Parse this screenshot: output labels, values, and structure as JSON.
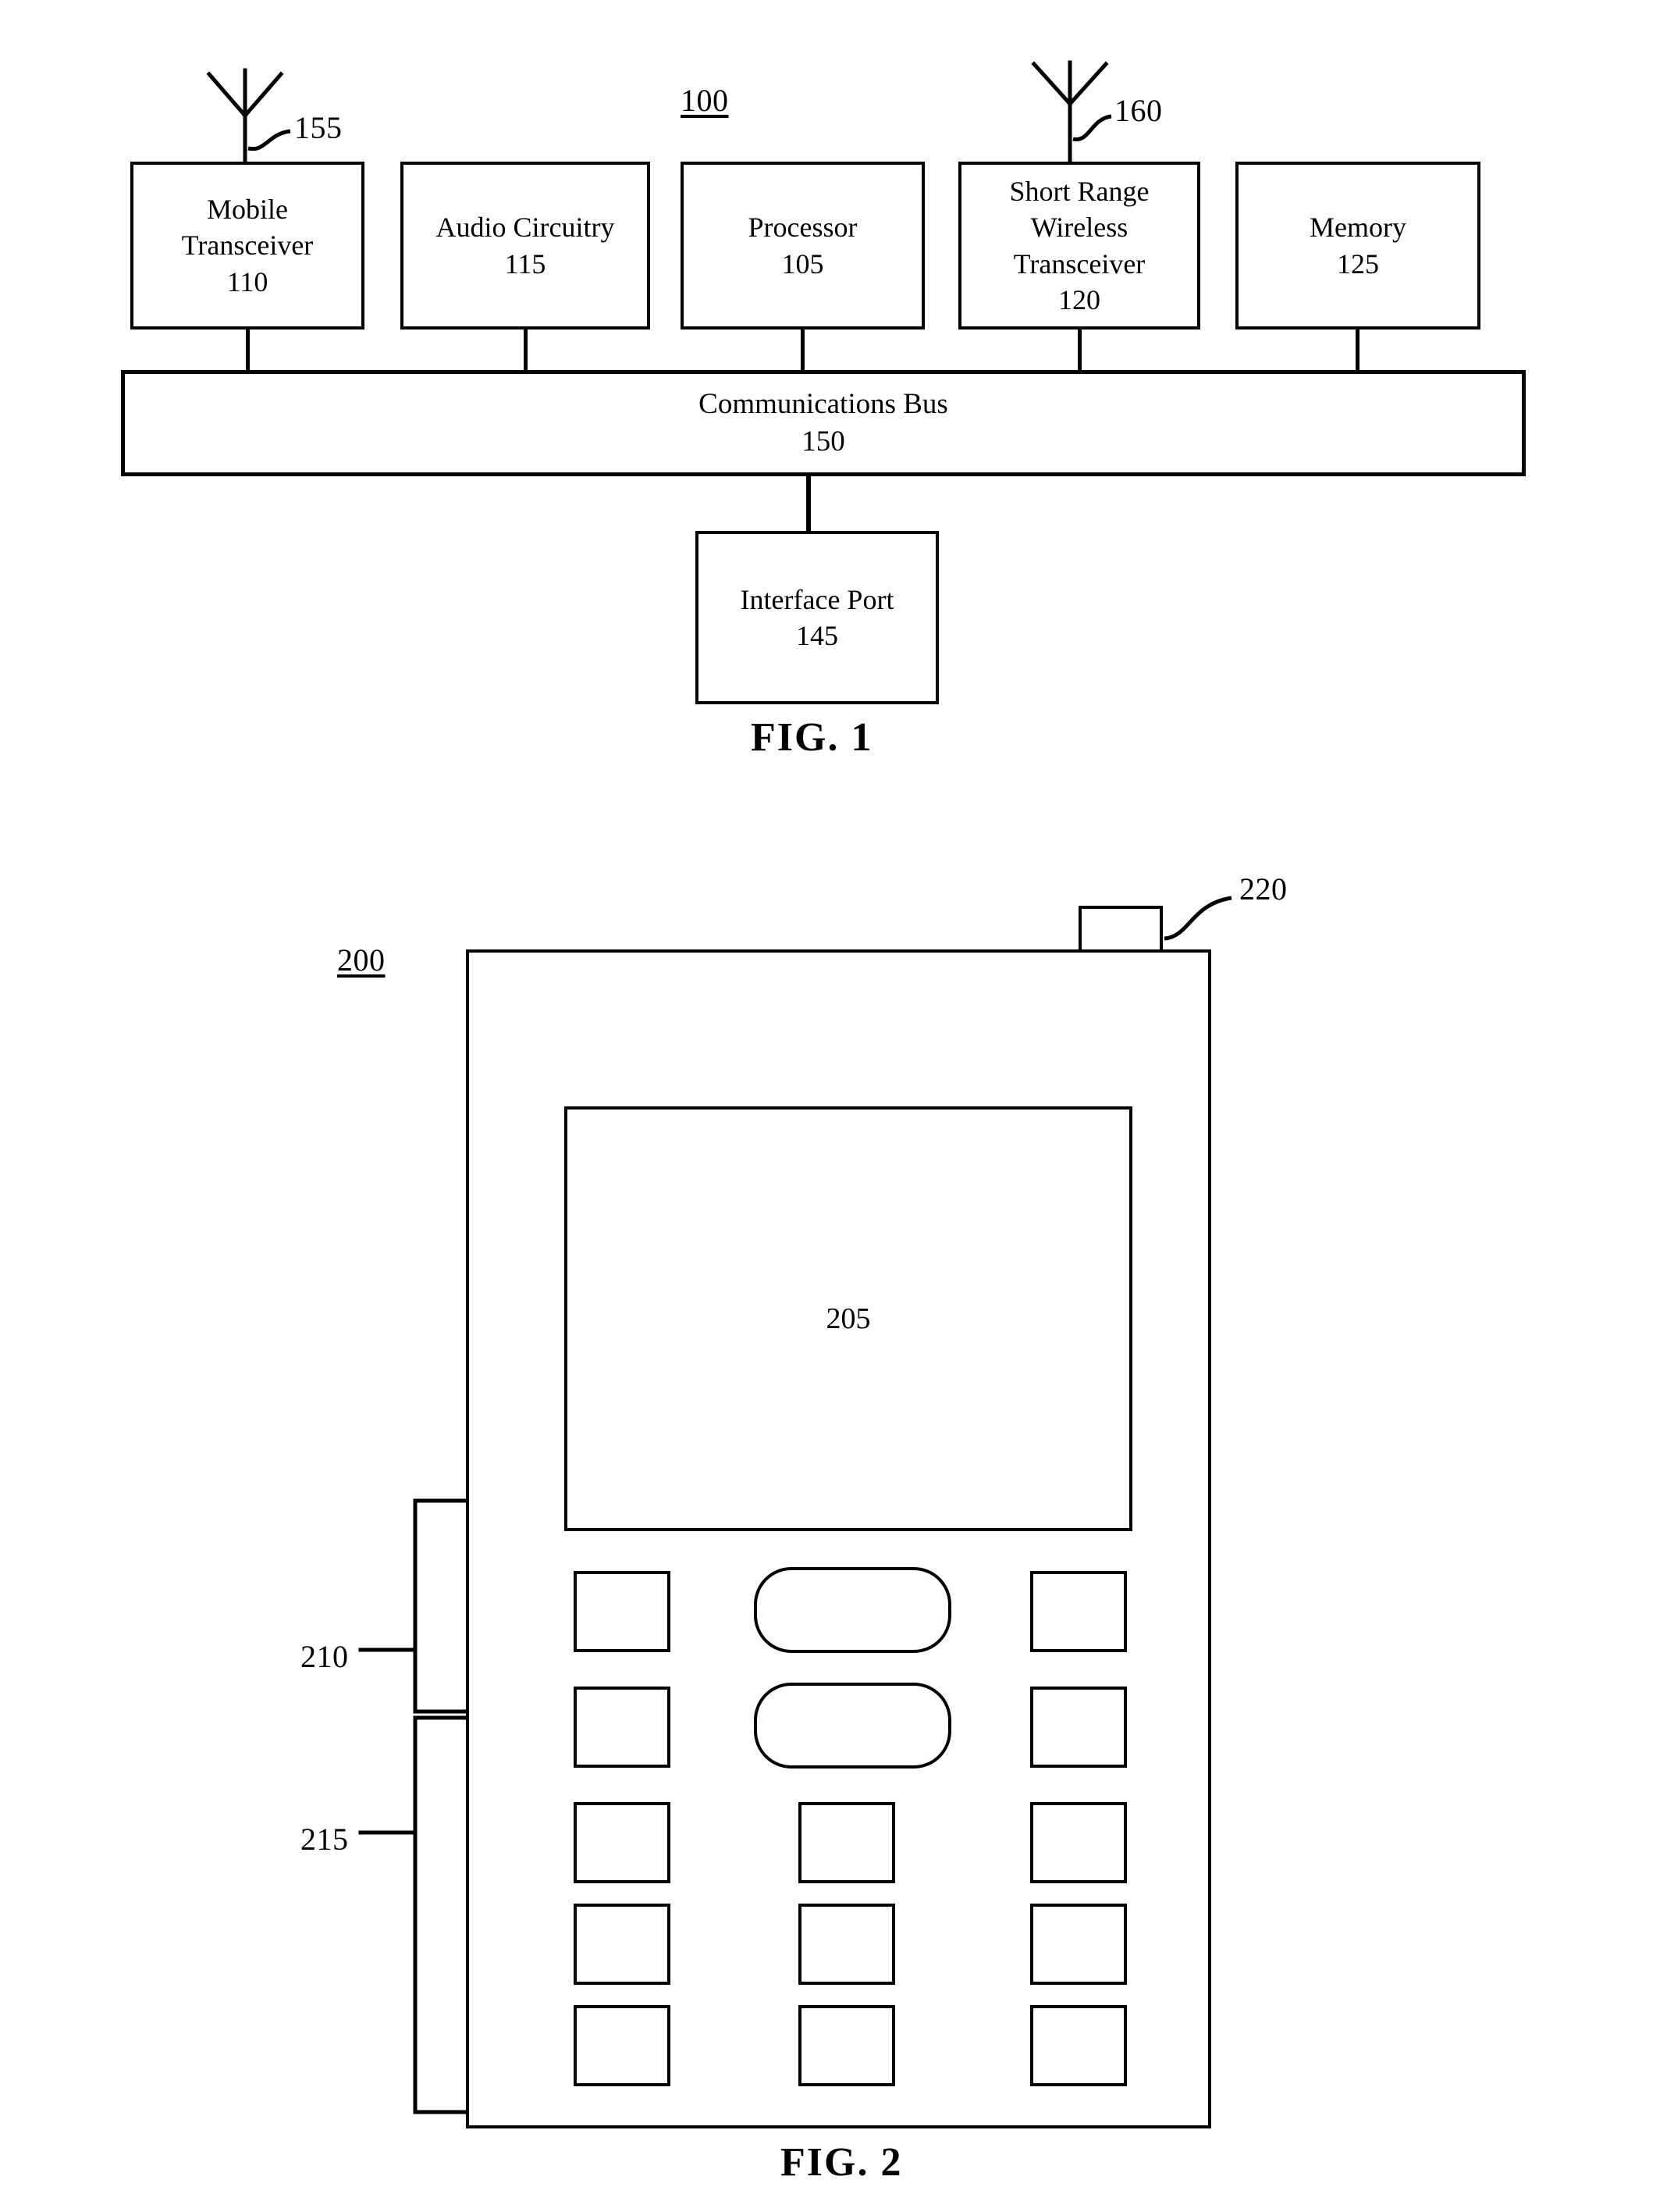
{
  "figures": [
    {
      "id": "fig1",
      "caption": "FIG. 1",
      "system_ref": "100",
      "blocks": [
        {
          "name": "mobile-transceiver",
          "lines": [
            "Mobile",
            "Transceiver",
            "110"
          ],
          "ref": "110"
        },
        {
          "name": "audio-circuitry",
          "lines": [
            "Audio Circuitry",
            "115"
          ],
          "ref": "115"
        },
        {
          "name": "processor",
          "lines": [
            "Processor",
            "105"
          ],
          "ref": "105"
        },
        {
          "name": "short-range-wireless-transceiver",
          "lines": [
            "Short Range",
            "Wireless",
            "Transceiver",
            "120"
          ],
          "ref": "120"
        },
        {
          "name": "memory",
          "lines": [
            "Memory",
            "125"
          ],
          "ref": "125"
        }
      ],
      "bus": {
        "lines": [
          "Communications Bus",
          "150"
        ],
        "ref": "150"
      },
      "interface_port": {
        "lines": [
          "Interface Port",
          "145"
        ],
        "ref": "145"
      },
      "antennas": [
        {
          "name": "mobile-antenna",
          "ref": "155"
        },
        {
          "name": "short-range-antenna",
          "ref": "160"
        }
      ]
    },
    {
      "id": "fig2",
      "caption": "FIG. 2",
      "device_ref": "200",
      "display_ref": "205",
      "top_tab_ref": "220",
      "upper_keys_ref": "210",
      "lower_keys_ref": "215",
      "keypad_rows": [
        {
          "left": "rect",
          "center": "pill",
          "right": "rect"
        },
        {
          "left": "rect",
          "center": "pill",
          "right": "rect"
        },
        {
          "left": "rect",
          "center": "rect",
          "right": "rect"
        },
        {
          "left": "rect",
          "center": "rect",
          "right": "rect"
        },
        {
          "left": "rect",
          "center": "rect",
          "right": "rect"
        }
      ]
    }
  ],
  "labels": {
    "fig1_caption": "FIG. 1",
    "fig2_caption": "FIG. 2",
    "ref_100": "100",
    "ref_155": "155",
    "ref_160": "160",
    "ref_200": "200",
    "ref_205": "205",
    "ref_210": "210",
    "ref_215": "215",
    "ref_220": "220",
    "mobile_transceiver_l1": "Mobile",
    "mobile_transceiver_l2": "Transceiver",
    "mobile_transceiver_l3": "110",
    "audio_circuitry_l1": "Audio Circuitry",
    "audio_circuitry_l2": "115",
    "processor_l1": "Processor",
    "processor_l2": "105",
    "short_range_l1": "Short Range",
    "short_range_l2": "Wireless",
    "short_range_l3": "Transceiver",
    "short_range_l4": "120",
    "memory_l1": "Memory",
    "memory_l2": "125",
    "bus_l1": "Communications Bus",
    "bus_l2": "150",
    "interface_port_l1": "Interface Port",
    "interface_port_l2": "145"
  },
  "colors": {
    "ink": "#000000",
    "paper": "#ffffff"
  }
}
